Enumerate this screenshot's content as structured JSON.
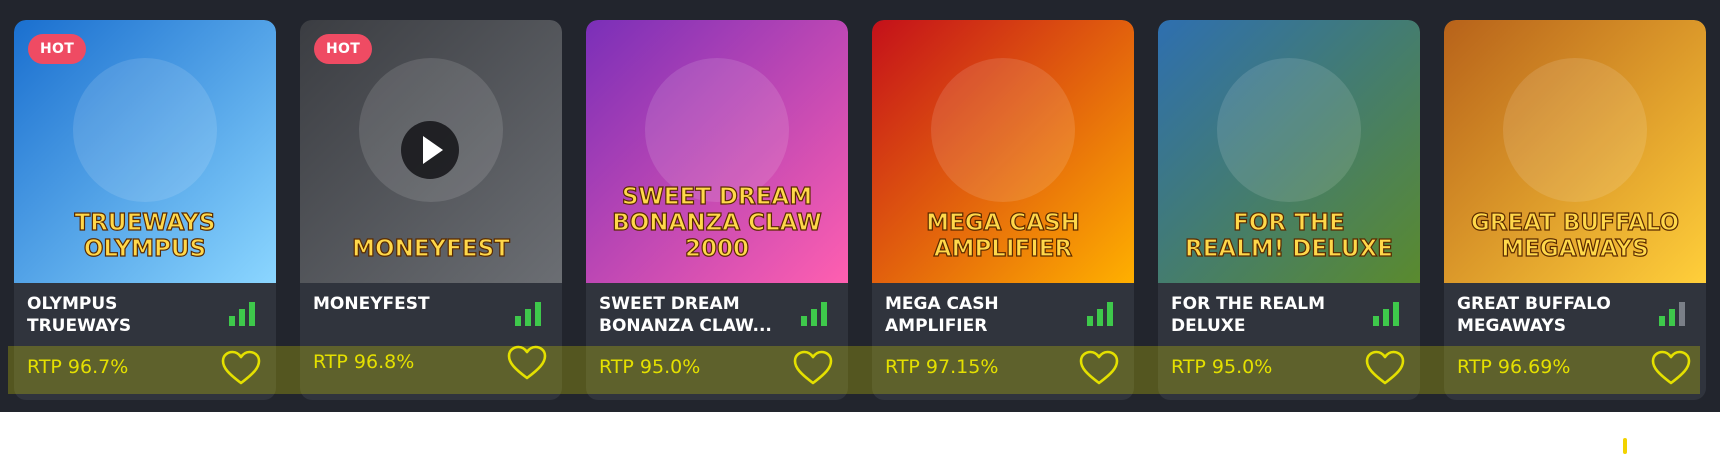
{
  "games": [
    {
      "name": "OLYMPUS\nTRUEWAYS",
      "rtp": "RTP 96.7%",
      "badge": "HOT",
      "art": "TRUEWAYS OLYMPUS",
      "colors": [
        "#1a6fcf",
        "#8bd6ff"
      ],
      "signal_level": 3
    },
    {
      "name": "MONEYFEST",
      "rtp": "RTP 96.8%",
      "badge": "HOT",
      "art": "MONEYFEST",
      "colors": [
        "#3b3d42",
        "#6b6e73"
      ],
      "signal_level": 3,
      "play_button": true
    },
    {
      "name": "SWEET DREAM\nBONANZA CLAW...",
      "rtp": "RTP 95.0%",
      "badge": "",
      "art": "SWEET DREAM BONANZA CLAW 2000",
      "colors": [
        "#7a2fb8",
        "#ff5fb0"
      ],
      "signal_level": 3
    },
    {
      "name": "MEGA CASH\nAMPLIFIER",
      "rtp": "RTP 97.15%",
      "badge": "",
      "art": "MEGA CASH AMPLIFIER",
      "colors": [
        "#c4101a",
        "#ffb000"
      ],
      "signal_level": 3
    },
    {
      "name": "FOR THE REALM\nDELUXE",
      "rtp": "RTP 95.0%",
      "badge": "",
      "art": "FOR THE REALM! DELUXE",
      "colors": [
        "#2e6fb0",
        "#5a8a2e"
      ],
      "signal_level": 3
    },
    {
      "name": "GREAT BUFFALO\nMEGAWAYS",
      "rtp": "RTP 96.69%",
      "badge": "",
      "art": "GREAT BUFFALO MEGAWAYS",
      "colors": [
        "#b7621a",
        "#ffcf3a"
      ],
      "signal_level": 2
    }
  ],
  "colors": {
    "background": "#22252d",
    "card": "#30343d",
    "rtp_text": "#e9e400",
    "signal_on": "#3ec84b",
    "signal_off": "#7a7f88",
    "badge": "#ef4b63"
  },
  "icons": {
    "favorite": "heart-icon",
    "signal": "signal-bars-icon",
    "play": "play-icon"
  }
}
